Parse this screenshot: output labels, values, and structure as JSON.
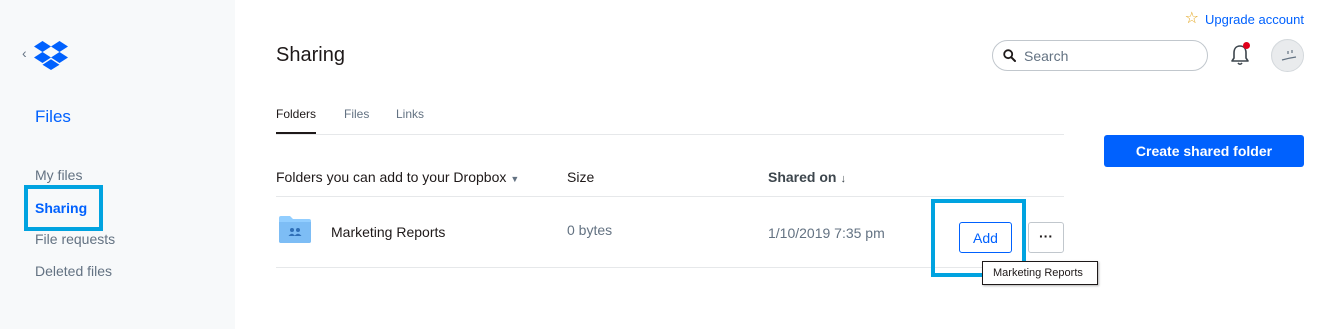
{
  "sidebar": {
    "title": "Files",
    "items": [
      {
        "label": "My files"
      },
      {
        "label": "Sharing"
      },
      {
        "label": "File requests"
      },
      {
        "label": "Deleted files"
      }
    ]
  },
  "header": {
    "title": "Sharing",
    "upgrade_label": "Upgrade account",
    "search_placeholder": "Search"
  },
  "tabs": [
    {
      "label": "Folders"
    },
    {
      "label": "Files"
    },
    {
      "label": "Links"
    }
  ],
  "create_button_label": "Create shared folder",
  "table": {
    "columns": [
      {
        "label": "Folders you can add to your Dropbox"
      },
      {
        "label": "Size"
      },
      {
        "label": "Shared on"
      }
    ],
    "rows": [
      {
        "name": "Marketing Reports",
        "size": "0 bytes",
        "shared_on": "1/10/2019 7:35 pm",
        "add_label": "Add",
        "more_label": "···"
      }
    ]
  },
  "tooltip": "Marketing Reports",
  "colors": {
    "accent": "#0061fe",
    "highlight": "#00a3e0",
    "notification": "#e0001b"
  }
}
